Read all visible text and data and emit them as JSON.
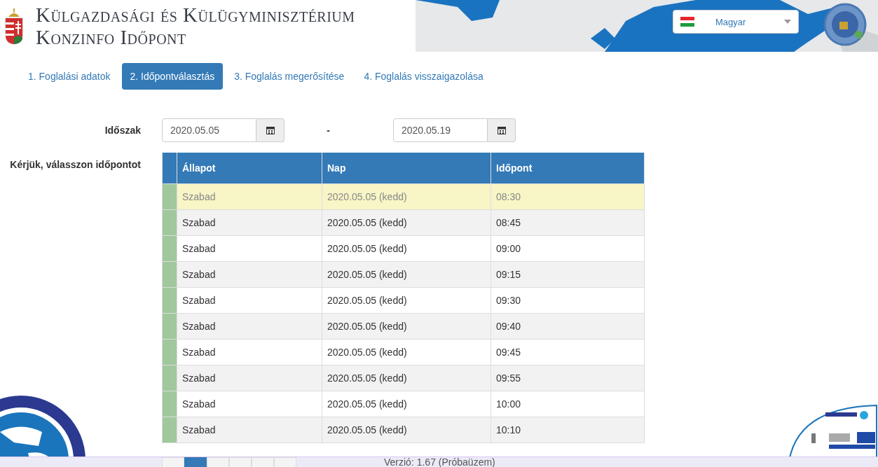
{
  "header": {
    "title_line1": "Külgazdasági és Külügyminisztérium",
    "title_line2": "Konzinfo Időpont",
    "language": {
      "value": "Magyar"
    }
  },
  "steps": [
    {
      "label": "1. Foglalási adatok",
      "selected": false
    },
    {
      "label": "2. Időpontválasztás",
      "selected": true
    },
    {
      "label": "3. Foglalás megerősítése",
      "selected": false
    },
    {
      "label": "4. Foglalás visszaigazolása",
      "selected": false
    }
  ],
  "period": {
    "label": "Időszak",
    "from": "2020.05.05",
    "separator": "-",
    "to": "2020.05.19"
  },
  "table_label": "Kérjük, válasszon időpontot",
  "table": {
    "columns": [
      "Állapot",
      "Nap",
      "Időpont"
    ],
    "rows": [
      {
        "status": "Szabad",
        "day": "2020.05.05 (kedd)",
        "time": "08:30",
        "selected": true,
        "color": "#a0c89c"
      },
      {
        "status": "Szabad",
        "day": "2020.05.05 (kedd)",
        "time": "08:45",
        "selected": false,
        "color": "#a0c89c"
      },
      {
        "status": "Szabad",
        "day": "2020.05.05 (kedd)",
        "time": "09:00",
        "selected": false,
        "color": "#a0c89c"
      },
      {
        "status": "Szabad",
        "day": "2020.05.05 (kedd)",
        "time": "09:15",
        "selected": false,
        "color": "#a0c89c"
      },
      {
        "status": "Szabad",
        "day": "2020.05.05 (kedd)",
        "time": "09:30",
        "selected": false,
        "color": "#a0c89c"
      },
      {
        "status": "Szabad",
        "day": "2020.05.05 (kedd)",
        "time": "09:40",
        "selected": false,
        "color": "#a0c89c"
      },
      {
        "status": "Szabad",
        "day": "2020.05.05 (kedd)",
        "time": "09:45",
        "selected": false,
        "color": "#a0c89c"
      },
      {
        "status": "Szabad",
        "day": "2020.05.05 (kedd)",
        "time": "09:55",
        "selected": false,
        "color": "#a0c89c"
      },
      {
        "status": "Szabad",
        "day": "2020.05.05 (kedd)",
        "time": "10:00",
        "selected": false,
        "color": "#a0c89c"
      },
      {
        "status": "Szabad",
        "day": "2020.05.05 (kedd)",
        "time": "10:10",
        "selected": false,
        "color": "#a0c89c"
      }
    ]
  },
  "pager": [
    {
      "selected": false
    },
    {
      "selected": true
    },
    {
      "selected": false
    },
    {
      "selected": false
    },
    {
      "selected": false
    },
    {
      "selected": false
    }
  ],
  "footer": {
    "version": "Verzió: 1.67 (Próbaüzem)"
  }
}
